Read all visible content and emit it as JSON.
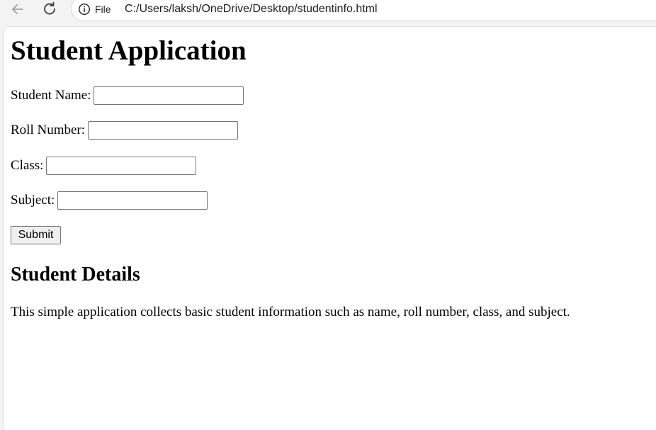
{
  "browser": {
    "site_info_label": "File",
    "url": "C:/Users/laksh/OneDrive/Desktop/studentinfo.html",
    "icons": [
      "back-arrow-icon",
      "reload-icon",
      "info-icon"
    ]
  },
  "page": {
    "title": "Student Application",
    "fields": [
      {
        "label": "Student Name:",
        "value": ""
      },
      {
        "label": "Roll Number:",
        "value": ""
      },
      {
        "label": "Class:",
        "value": ""
      },
      {
        "label": "Subject:",
        "value": ""
      }
    ],
    "submit_label": "Submit",
    "details_heading": "Student Details",
    "details_text": "This simple application collects basic student information such as name, roll number, class, and subject."
  }
}
